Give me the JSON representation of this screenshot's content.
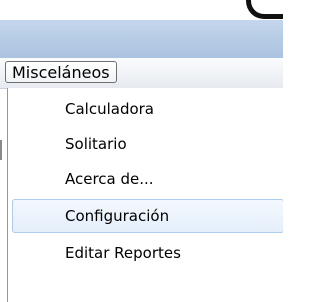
{
  "menubar": {
    "items": [
      {
        "label": "Misceláneos"
      }
    ]
  },
  "dropdown": {
    "items": [
      {
        "label": "Calculadora"
      },
      {
        "label": "Solitario"
      },
      {
        "label": "Acerca de..."
      },
      {
        "label": "Configuración",
        "highlighted": true
      },
      {
        "label": "Editar Reportes"
      }
    ]
  },
  "colors": {
    "title_band": "#b7cde6",
    "menubar_bg": "#eef1f5",
    "hover_bg": "#e4effb",
    "hover_border": "#aeccee"
  }
}
